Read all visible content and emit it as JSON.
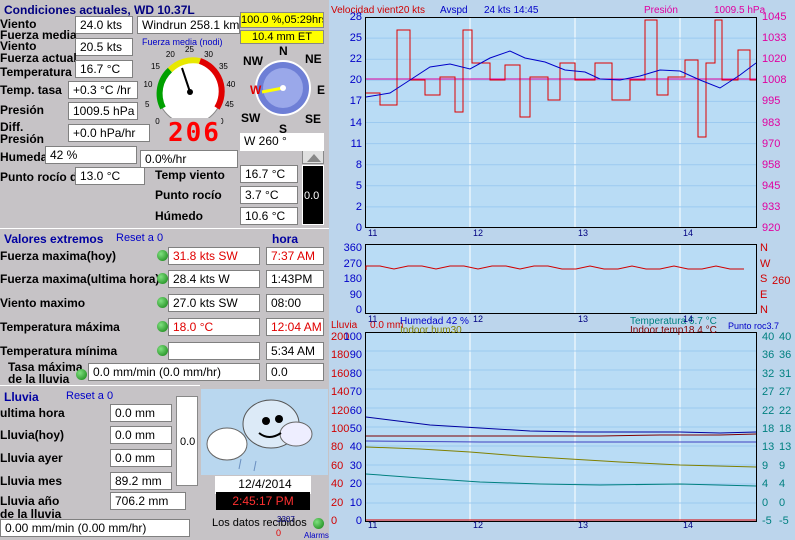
{
  "title": "Condiciones actuales, WD 10.37L",
  "current": {
    "viento_label": "Viento",
    "viento_val": "24.0 kts",
    "fmedia_label": "Fuerza media",
    "viento2_label": "Viento",
    "viento2_val": "20.5 kts",
    "factual_label": "Fuerza actual",
    "temp_label": "Temperatura",
    "temp_val": "16.7 °C",
    "ttasa_label": "Temp. tasa",
    "ttasa_val": "+0.3 °C /hr",
    "presion_label": "Presión",
    "presion_val": "1009.5 hPa",
    "diff_label": "Diff.",
    "diffp_label": "Presión",
    "diff_val": "+0.0 hPa/hr",
    "hum_label": "Humedad",
    "hum_val": "42 %",
    "hum_rate": "0.0%/hr",
    "rocio_label": "Punto rocío dep.",
    "rocio_val": "13.0 °C",
    "tviento_label": "Temp viento",
    "tviento_val": "16.7 °C",
    "procio_label": "Punto rocío",
    "procio_val": "3.7 °C",
    "humedo_label": "Húmedo",
    "humedo_val": "10.6 °C",
    "windrun": "Windrun 258.1 km",
    "yellow1": "100.0 %,05:29hrs",
    "yellow2": "10.4 mm ET",
    "gauge_title": "Fuerza media (nodi)",
    "gauge_digits": "206",
    "dir_text": "W  260 °",
    "side_val": "0.0"
  },
  "compass": {
    "n": "N",
    "s": "S",
    "e": "E",
    "w": "W",
    "ne": "NE",
    "nw": "NW",
    "se": "SE",
    "sw": "SW"
  },
  "gauge_ticks": [
    "0",
    "5",
    "10",
    "15",
    "20",
    "25",
    "30",
    "35",
    "40",
    "45",
    "50"
  ],
  "extremes": {
    "header": "Valores extremos",
    "reset": "Reset a 0",
    "hora_header": "hora",
    "rows": [
      {
        "label": "Fuerza maxima(hoy)",
        "value": "31.8 kts  SW",
        "time": "7:37 AM",
        "red": true
      },
      {
        "label": "Fuerza maxima(ultima hora)",
        "value": "28.4 kts  W",
        "time": "1:43PM",
        "red": false
      },
      {
        "label": "Viento maximo",
        "value": "27.0 kts  SW",
        "time": "08:00",
        "red": false
      },
      {
        "label": "Temperatura máxima",
        "value": "18.0 °C",
        "time": "12:04 AM",
        "red": true
      },
      {
        "label": "Temperatura mínima",
        "value": "",
        "time": "5:34 AM",
        "red": false
      }
    ],
    "tasa_label1": "Tasa máxima",
    "tasa_label2": "de la lluvia",
    "tasa_val": "0.0 mm/min (0.0 mm/hr)",
    "tasa_time": "0.0"
  },
  "rain": {
    "header": "Lluvia",
    "reset": "Reset a 0",
    "rows": [
      {
        "label": "ultima hora",
        "value": "0.0 mm"
      },
      {
        "label": "Lluvia(hoy)",
        "value": "0.0 mm"
      },
      {
        "label": "Lluvia ayer",
        "value": "0.0 mm"
      },
      {
        "label": "Lluvia mes",
        "value": "89.2 mm"
      }
    ],
    "year_label1": "Lluvia año",
    "year_label2": "de la lluvia",
    "year_val": "706.2 mm",
    "rate": "0.00 mm/min (0.00 mm/hr)",
    "gauge_val": "0.0"
  },
  "footer": {
    "date": "12/4/2014",
    "time": "2:45:17 PM",
    "datos": "Los datos recibidos",
    "count": "3307",
    "zero": "0",
    "alarms": "Alarms"
  },
  "charts": {
    "top_title_left": "Velocidad vient20 kts",
    "top_title_mid": "Avspd",
    "top_title_mid2": "24 kts  14:45",
    "top_title_right": "Presión",
    "top_title_right2": "1009.5 hPa",
    "top_left_ticks": [
      "28",
      "25",
      "22",
      "20",
      "17",
      "14",
      "11",
      "8",
      "5",
      "2",
      "0"
    ],
    "top_right_ticks": [
      "1045",
      "1033",
      "1020",
      "1008",
      "995",
      "983",
      "970",
      "958",
      "945",
      "933",
      "920"
    ],
    "time_ticks": [
      "11",
      "12",
      "13",
      "14"
    ],
    "mid_left_ticks": [
      "360",
      "270",
      "180",
      "90",
      "0"
    ],
    "mid_right_ticks": [
      "N",
      "W",
      "S",
      "E",
      "N"
    ],
    "mid_right_val": "260",
    "bot_title_lluvia": "Lluvia",
    "bot_title_lluvia_val": "0.0 mm",
    "bot_title_hum": "Humedad 42 %",
    "bot_title_indoor": "Indoor hum30",
    "bot_title_temp": "Temperatura 6.7 °C",
    "bot_title_indoortemp": "Indoor temp18.4 °C",
    "bot_title_rocio": "Punto roc3.7",
    "bot_left_ticks": [
      "100",
      "90",
      "80",
      "70",
      "60",
      "50",
      "40",
      "30",
      "20",
      "10",
      "0"
    ],
    "bot_left2_ticks": [
      "200",
      "180",
      "160",
      "140",
      "120",
      "100",
      "80",
      "60",
      "40",
      "20",
      "0"
    ],
    "bot_right_ticks": [
      "40",
      "36",
      "32",
      "27",
      "22",
      "18",
      "13",
      "9",
      "4",
      "0",
      "-5"
    ],
    "bot_right2_ticks": [
      "40",
      "36",
      "31",
      "27",
      "22",
      "18",
      "13",
      "9",
      "4",
      "0",
      "-5"
    ]
  }
}
